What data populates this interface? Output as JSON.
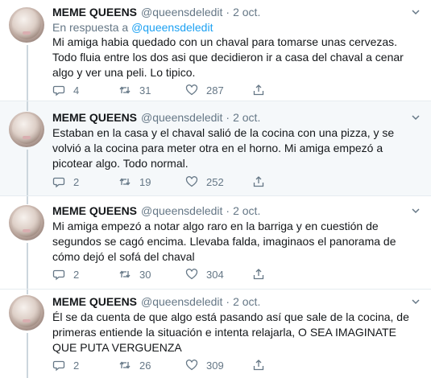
{
  "tweets": [
    {
      "name": "MEME QUEENS",
      "handle": "@queensdeledit",
      "separator": "·",
      "date": "2 oct.",
      "reply_prefix": "En respuesta a",
      "reply_handle": "@queensdeledit",
      "text": "Mi amiga habia quedado con un chaval para tomarse unas cervezas. Todo fluia entre los dos asi que decidieron ir a casa del chaval a cenar algo y ver una peli. Lo tipico.",
      "replies": "4",
      "retweets": "31",
      "likes": "287"
    },
    {
      "name": "MEME QUEENS",
      "handle": "@queensdeledit",
      "separator": "·",
      "date": "2 oct.",
      "text": "Estaban en la casa y el chaval salió de la cocina con una pizza, y se volvió a la cocina para meter otra en el horno. Mi amiga empezó a picotear algo. Todo normal.",
      "replies": "2",
      "retweets": "19",
      "likes": "252"
    },
    {
      "name": "MEME QUEENS",
      "handle": "@queensdeledit",
      "separator": "·",
      "date": "2 oct.",
      "text": "Mi amiga empezó a notar algo raro en la barriga y en cuestión de segundos se cagó encima. Llevaba falda, imaginaos el panorama de cómo dejó el sofá del chaval",
      "replies": "2",
      "retweets": "30",
      "likes": "304"
    },
    {
      "name": "MEME QUEENS",
      "handle": "@queensdeledit",
      "separator": "·",
      "date": "2 oct.",
      "text": "Él se da cuenta de que algo está pasando así que sale de la cocina, de primeras entiende la situación e intenta relajarla, O SEA IMAGINATE QUE PUTA VERGUENZA",
      "replies": "2",
      "retweets": "26",
      "likes": "309"
    }
  ],
  "icons": {
    "reply": "reply-icon",
    "retweet": "retweet-icon",
    "like": "heart-icon",
    "share": "share-icon",
    "caret": "chevron-down-icon"
  },
  "colors": {
    "text": "#14171a",
    "secondary": "#657786",
    "link": "#1da1f2",
    "highlight_background": "#f5f8fa",
    "divider": "#e6ecf0",
    "thread_line": "#ccd6dd"
  }
}
